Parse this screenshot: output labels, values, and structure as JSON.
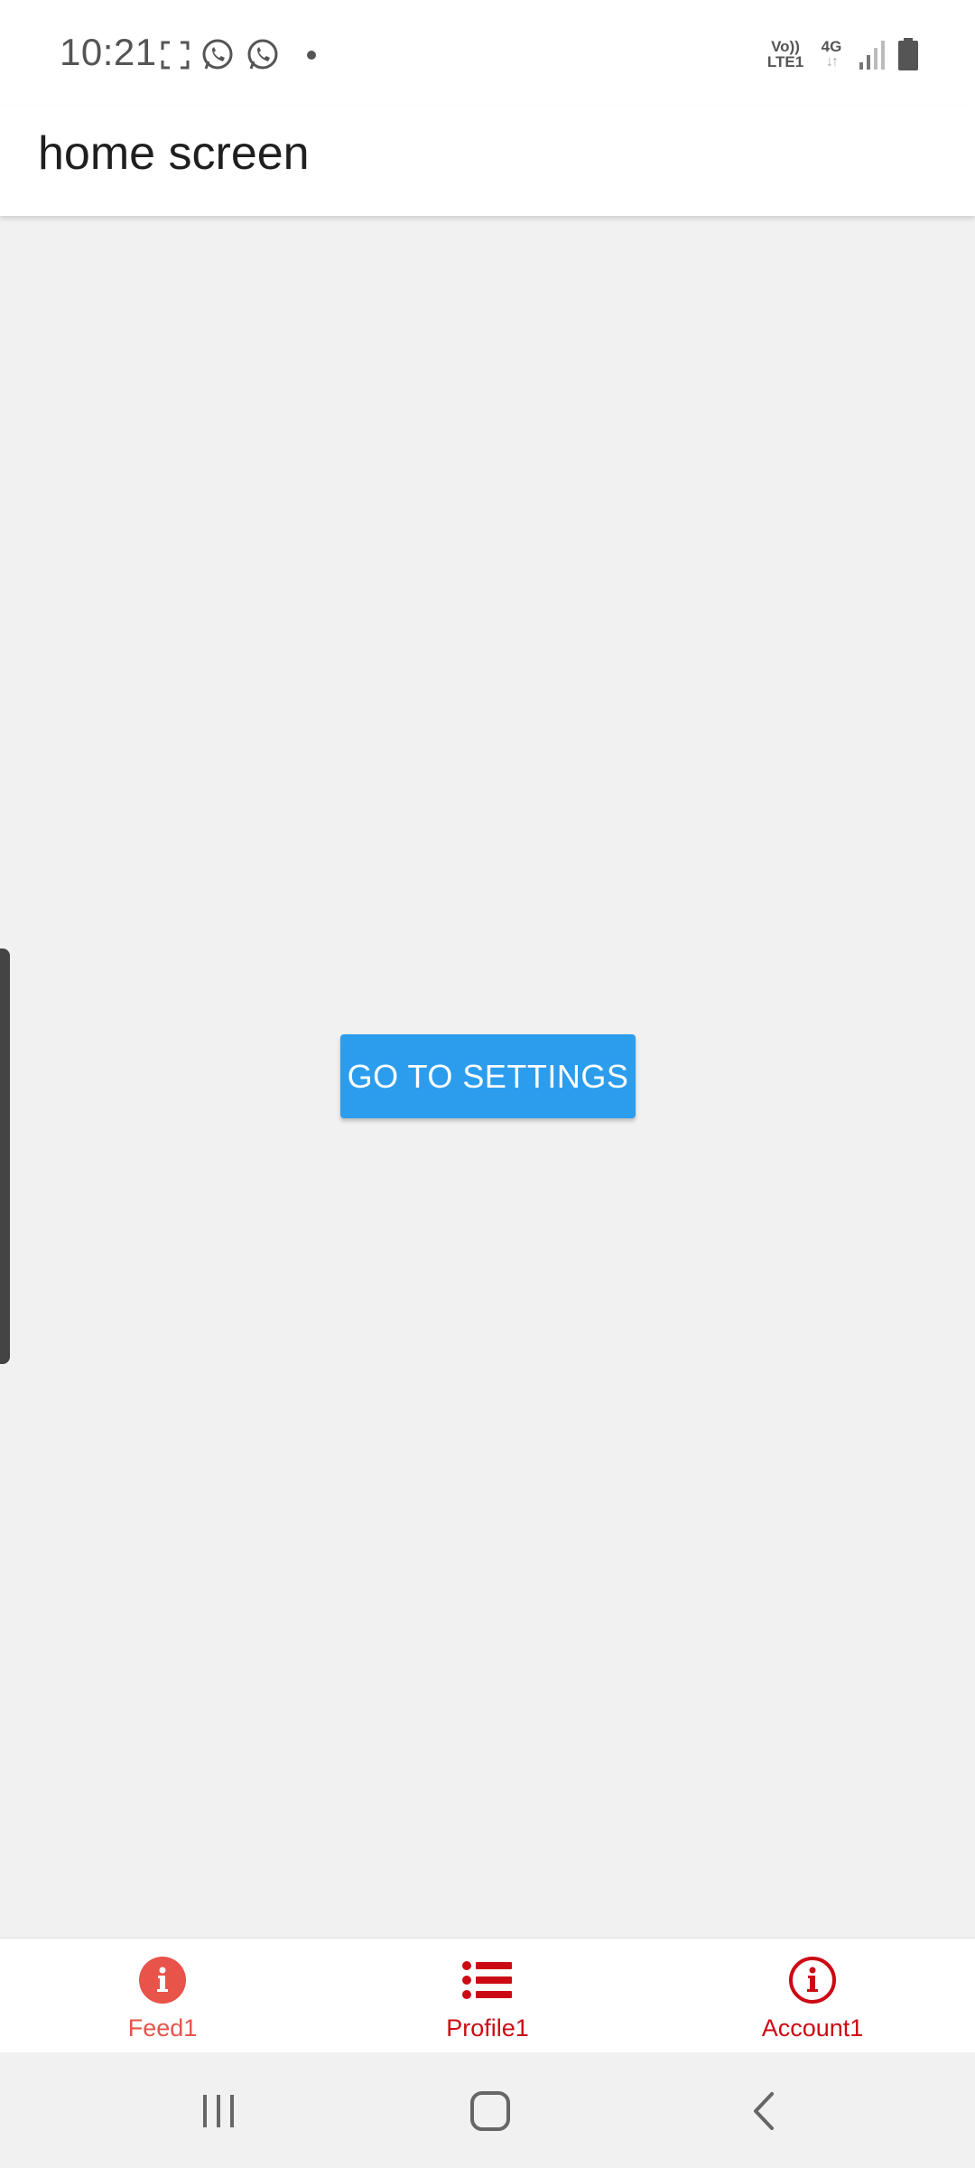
{
  "status_bar": {
    "time": "10:21",
    "left_icons": [
      "screenshot-frame-icon",
      "whatsapp-icon",
      "whatsapp-icon",
      "notification-dot-icon"
    ],
    "volte_line1": "Vo))",
    "volte_line2": "LTE1",
    "network_type": "4G",
    "network_arrows": "↓↑",
    "right_icons": [
      "volte-icon",
      "network-4g-icon",
      "signal-icon",
      "battery-icon"
    ]
  },
  "app_bar": {
    "title": "home screen"
  },
  "main": {
    "button_label": "GO TO SETTINGS"
  },
  "tabs": [
    {
      "label": "Feed1",
      "icon": "info-filled-icon",
      "color": "#e8534a"
    },
    {
      "label": "Profile1",
      "icon": "list-icon",
      "color": "#cc0a14"
    },
    {
      "label": "Account1",
      "icon": "info-outline-icon",
      "color": "#cc0a14"
    }
  ],
  "nav_bar": {
    "buttons": [
      "recent-apps-icon",
      "home-icon",
      "back-icon"
    ]
  },
  "colors": {
    "primary_button": "#2c9ded",
    "active_tab": "#e8534a",
    "inactive_tab": "#cc0a14",
    "background": "#f1f1f1"
  }
}
